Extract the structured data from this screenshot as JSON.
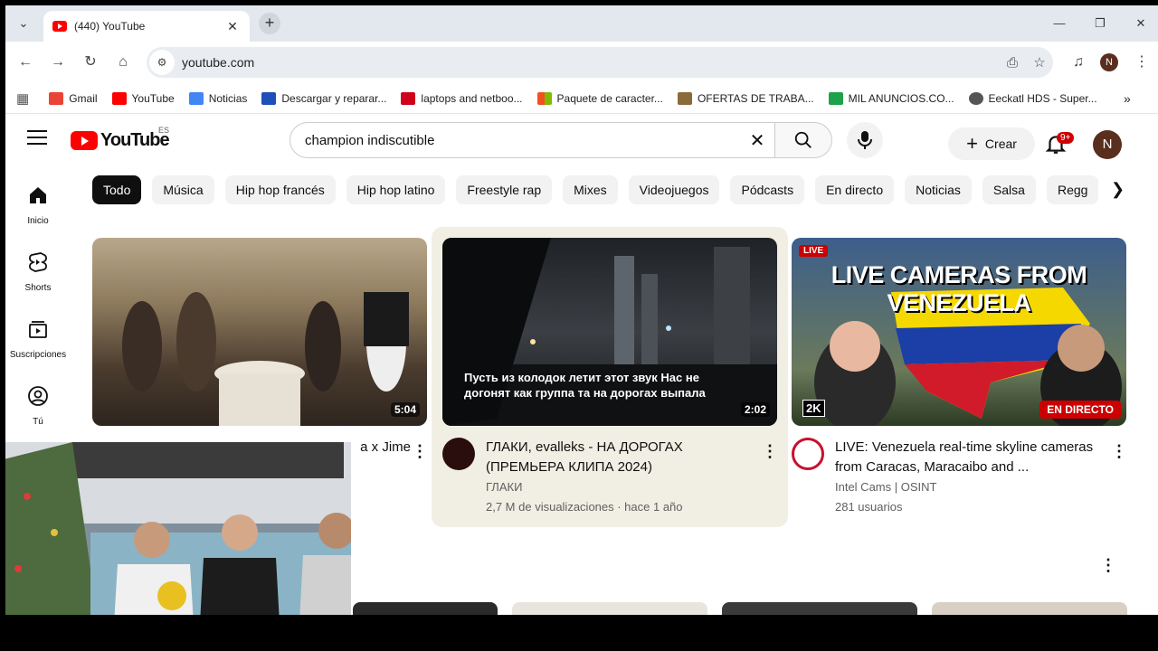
{
  "browser": {
    "tab_title": "(440) YouTube",
    "url": "youtube.com",
    "profile_initial": "N"
  },
  "bookmarks": [
    {
      "label": "Gmail",
      "color": "#ea4335"
    },
    {
      "label": "YouTube",
      "color": "#ff0000"
    },
    {
      "label": "Noticias",
      "color": "#4285f4"
    },
    {
      "label": "Descargar y reparar...",
      "color": "#1f4fb8"
    },
    {
      "label": "laptops and netboo...",
      "color": "#d0021b"
    },
    {
      "label": "Paquete de caracter...",
      "color": "#f25022"
    },
    {
      "label": "OFERTAS DE TRABA...",
      "color": "#8b6b3a"
    },
    {
      "label": "MIL ANUNCIOS.CO...",
      "color": "#1ea14a"
    },
    {
      "label": "Eeckatl HDS - Super...",
      "color": "#555555"
    }
  ],
  "youtube": {
    "logo_text": "YouTube",
    "region": "ES",
    "search_query": "champion indiscutible",
    "create_label": "Crear",
    "notif_count": "9+",
    "avatar_initial": "N"
  },
  "sidebar": [
    {
      "label": "Inicio",
      "icon": "home-icon"
    },
    {
      "label": "Shorts",
      "icon": "shorts-icon"
    },
    {
      "label": "Suscripciones",
      "icon": "subscriptions-icon"
    },
    {
      "label": "Tú",
      "icon": "you-icon"
    }
  ],
  "chips": [
    "Todo",
    "Música",
    "Hip hop francés",
    "Hip hop latino",
    "Freestyle rap",
    "Mixes",
    "Videojuegos",
    "Pódcasts",
    "En directo",
    "Noticias",
    "Salsa",
    "Regg"
  ],
  "videos": [
    {
      "duration": "5:04",
      "title_visible": "a x Jime"
    },
    {
      "duration": "2:02",
      "overlay_text": "Пусть из колодок летит этот звук Нас не догонят как группа та на дорогах выпала",
      "title": "ГЛАКИ, evalleks - НА ДОРОГАХ (ПРЕМЬЕРА КЛИПА 2024)",
      "channel": "ГЛАКИ",
      "stats": "2,7 M de visualizaciones · hace 1 año"
    },
    {
      "live_badge": "LIVE",
      "thumb_title": "LIVE CAMERAS FROM VENEZUELA",
      "quality": "2K",
      "live_label": "EN DIRECTO",
      "title": "LIVE: Venezuela real-time skyline cameras from Caracas, Maracaibo and ...",
      "channel": "Intel Cams | OSINT",
      "stats": "281 usuarios"
    }
  ]
}
